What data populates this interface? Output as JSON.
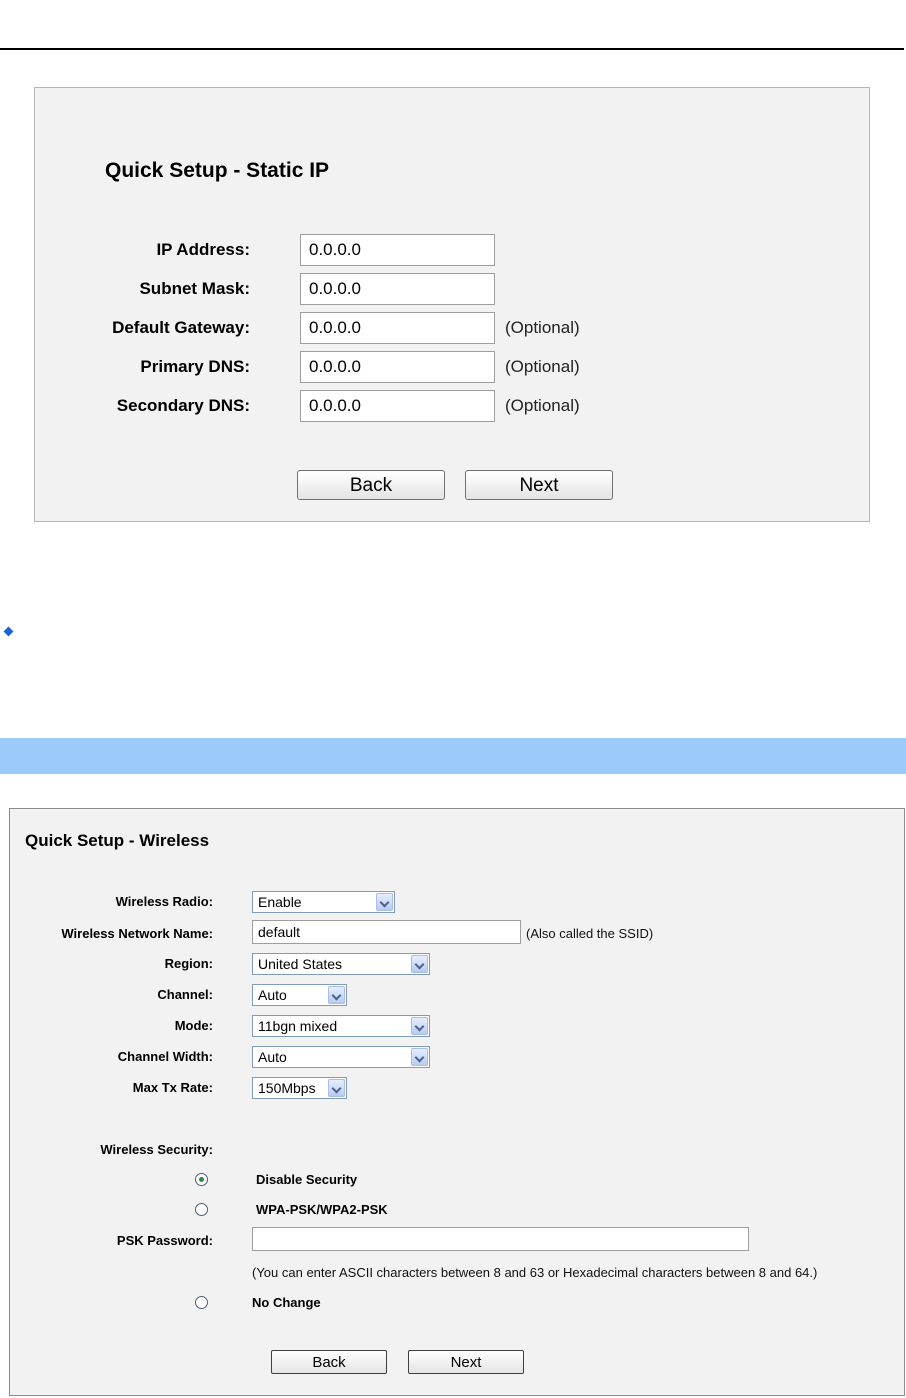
{
  "static_ip": {
    "title": "Quick Setup - Static IP",
    "fields": [
      {
        "label": "IP Address:",
        "value": "0.0.0.0",
        "note": ""
      },
      {
        "label": "Subnet Mask:",
        "value": "0.0.0.0",
        "note": ""
      },
      {
        "label": "Default Gateway:",
        "value": "0.0.0.0",
        "note": "(Optional)"
      },
      {
        "label": "Primary DNS:",
        "value": "0.0.0.0",
        "note": "(Optional)"
      },
      {
        "label": "Secondary DNS:",
        "value": "0.0.0.0",
        "note": "(Optional)"
      }
    ],
    "back_label": "Back",
    "next_label": "Next"
  },
  "wireless": {
    "title": "Quick Setup - Wireless",
    "radio_label": "Wireless Radio:",
    "radio_value": "Enable",
    "ssid_label": "Wireless Network Name:",
    "ssid_value": "default",
    "ssid_note": "(Also called the SSID)",
    "region_label": "Region:",
    "region_value": "United States",
    "channel_label": "Channel:",
    "channel_value": "Auto",
    "mode_label": "Mode:",
    "mode_value": "11bgn mixed",
    "width_label": "Channel Width:",
    "width_value": "Auto",
    "rate_label": "Max Tx Rate:",
    "rate_value": "150Mbps",
    "security_label": "Wireless Security:",
    "opt_disable": "Disable Security",
    "opt_wpa": "WPA-PSK/WPA2-PSK",
    "psk_label": "PSK Password:",
    "psk_value": "",
    "psk_note": "(You can enter ASCII characters between 8 and 63 or Hexadecimal characters between 8 and 64.)",
    "opt_nochange": "No Change",
    "selected_security": "Disable Security",
    "back_label": "Back",
    "next_label": "Next"
  },
  "colors": {
    "panel_bg": "#f2f2f2",
    "banner": "#9bcbfb",
    "bullet": "#1a64d8"
  }
}
